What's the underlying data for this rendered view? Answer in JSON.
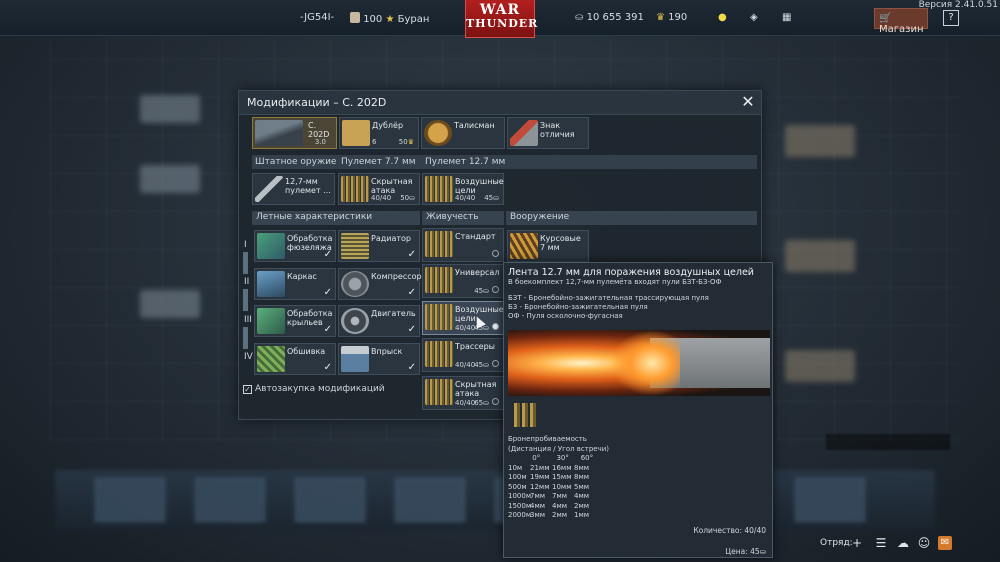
{
  "topbar": {
    "player": "-JG54I-",
    "eagles_reserve": "100",
    "squad_name": "Буран",
    "silver": "10 655 391",
    "gold": "190",
    "shop_label": "Магазин",
    "help_label": "?",
    "version": "Версия 2.41.0.51",
    "logo_line1": "WAR",
    "logo_line2": "THUNDER"
  },
  "dialog": {
    "title": "Модификации – C. 202D",
    "vehicle": {
      "name": "C. 202D",
      "br": "3.0"
    },
    "crew_cards": [
      {
        "label": "Дублёр",
        "count": "6",
        "price": "50"
      },
      {
        "label": "Талисман"
      },
      {
        "label": "Знак отличия"
      }
    ],
    "weapon_headers": [
      "Штатное оружие",
      "Пулемет 7.7 мм",
      "Пулемет 12.7 мм"
    ],
    "weapon_cards": [
      {
        "label": "12,7-мм пулемет ..."
      },
      {
        "label": "Скрытная атака",
        "count": "40/40",
        "price": "50"
      },
      {
        "label": "Воздушные цели",
        "count": "40/40",
        "price": "45"
      }
    ],
    "section_headers": {
      "flight": "Летные характеристики",
      "survivability": "Живучесть",
      "armament": "Вооружение"
    },
    "flight_cards": [
      {
        "label": "Обработка фюзеляжа"
      },
      {
        "label": "Радиатор"
      },
      {
        "label": "Каркас"
      },
      {
        "label": "Компрессор"
      },
      {
        "label": "Обработка крыльев"
      },
      {
        "label": "Двигатель"
      },
      {
        "label": "Обшивка"
      },
      {
        "label": "Впрыск"
      }
    ],
    "tiers": [
      "I",
      "II",
      "III",
      "IV"
    ],
    "belts": [
      {
        "label": "Стандарт"
      },
      {
        "label": "Универсал",
        "price": "45"
      },
      {
        "label": "Воздушные цели",
        "count": "40/40",
        "price": "45"
      },
      {
        "label": "Трассеры",
        "count": "40/40",
        "price": "45"
      },
      {
        "label": "Скрытная атака",
        "count": "40/40",
        "price": "65"
      }
    ],
    "armament_card": {
      "label": "Курсовые 7 мм"
    },
    "auto_buy": "Автозакупка модификаций"
  },
  "tooltip": {
    "title": "Лента 12.7 мм для поражения воздушных целей",
    "subtitle": "В боекомплект 12,7-мм пулемёта входят пули БЗТ-БЗ-ОФ",
    "legend": [
      "БЗТ - Бронебойно-зажигательная трассирующая пуля",
      "БЗ - Бронебойно-зажигательная пуля",
      "ОФ - Пуля осколочно-фугасная"
    ],
    "pen_title": "Бронепробиваемость",
    "pen_subtitle": "(Дистанция / Угол встречи)",
    "angles": [
      "0°",
      "30°",
      "60°"
    ],
    "pen_rows": [
      [
        "10м",
        "21мм",
        "16мм",
        "8мм"
      ],
      [
        "100м",
        "19мм",
        "15мм",
        "8мм"
      ],
      [
        "500м",
        "12мм",
        "10мм",
        "5мм"
      ],
      [
        "1000м",
        "7мм",
        "7мм",
        "4мм"
      ],
      [
        "1500м",
        "4мм",
        "4мм",
        "2мм"
      ],
      [
        "2000м",
        "3мм",
        "2мм",
        "1мм"
      ]
    ],
    "quantity": "Количество: 40/40",
    "price": "Цена: 45"
  },
  "tray": {
    "squad_label": "Отряд:"
  },
  "colors": {
    "accent_red": "#b3201e",
    "shop_brown": "#6a3b2d",
    "panel": "#2b353f"
  }
}
